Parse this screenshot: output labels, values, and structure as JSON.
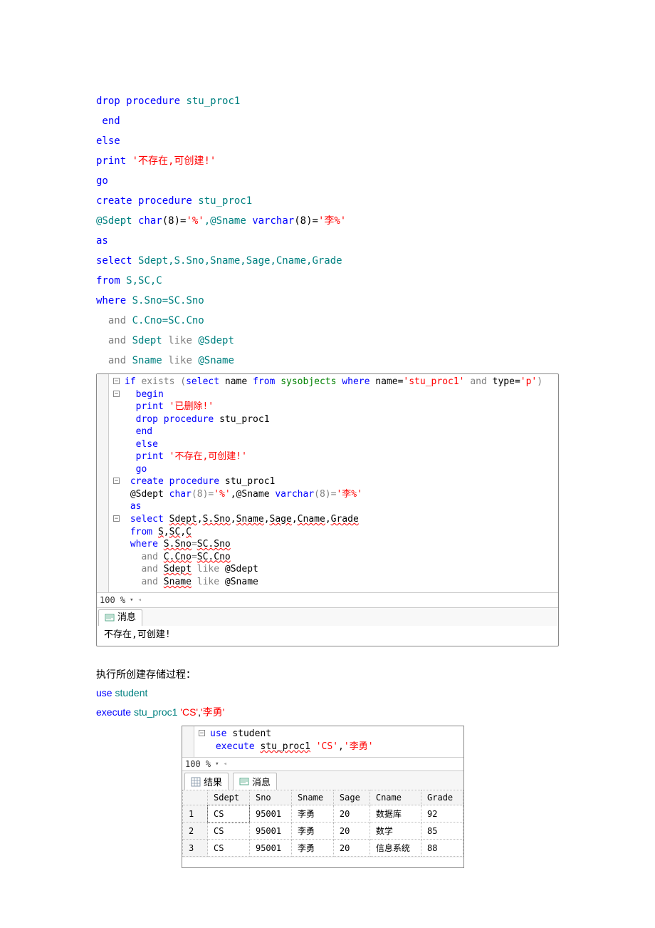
{
  "top_code": {
    "l1": " drop procedure stu_proc1",
    "l1_kw": "drop procedure",
    "l1_name": "stu_proc1",
    "l2": " end",
    "l3": "else",
    "l4a": "print",
    "l4b": "'不存在,可创建!'",
    "l5": "go",
    "l6a": "create procedure",
    "l6b": "stu_proc1",
    "l7a": "@Sdept",
    "l7b": "char",
    "l7c": "(8)=",
    "l7d": "'%'",
    "l7e": ",@Sname",
    "l7f": "varchar",
    "l7g": "(8)=",
    "l7h": "'李%'",
    "l8": "as",
    "l9a": "select",
    "l9b": "Sdept,S.Sno,Sname,Sage,Cname,Grade",
    "l10a": "from",
    "l10b": "S,SC,C",
    "l11a": "where",
    "l11b": "S.Sno=SC.Sno",
    "l12a": "and",
    "l12b": "C.Cno=SC.Cno",
    "l13a": "and",
    "l13b": "Sdept",
    "l13c": "like",
    "l13d": "@Sdept",
    "l14a": "and",
    "l14b": "Sname",
    "l14c": "like",
    "l14d": "@Sname"
  },
  "editor1": {
    "l1a": "if",
    "l1b": "exists",
    "l1c": "(",
    "l1d": "select",
    "l1e": "name",
    "l1f": "from",
    "l1g": "sysobjects",
    "l1h": "where",
    "l1i": "name=",
    "l1j": "'stu_proc1'",
    "l1k": "and",
    "l1l": "type=",
    "l1m": "'p'",
    "l1n": ")",
    "l2": "  begin",
    "l3a": "  print",
    "l3b": "'已删除!'",
    "l4a": "  drop",
    "l4b": "procedure",
    "l4c": "stu_proc1",
    "l5": "  end",
    "l6": "  else",
    "l7a": "  print",
    "l7b": "'不存在,可创建!'",
    "l8": "  go",
    "l9a": " create",
    "l9b": "procedure",
    "l9c": "stu_proc1",
    "l10a": " @Sdept",
    "l10b": "char",
    "l10c": "(8)=",
    "l10d": "'%'",
    "l10e": ",@Sname",
    "l10f": "varchar",
    "l10g": "(8)=",
    "l10h": "'李%'",
    "l11": " as",
    "l12a": " select",
    "l12b": "Sdept",
    "l12c": ",",
    "l12d": "S.Sno",
    "l12e": ",",
    "l12f": "Sname",
    "l12g": ",",
    "l12h": "Sage",
    "l12i": ",",
    "l12j": "Cname",
    "l12k": ",",
    "l12l": "Grade",
    "l13a": " from",
    "l13b": "S",
    "l13c": ",",
    "l13d": "SC",
    "l13e": ",",
    "l13f": "C",
    "l14a": " where",
    "l14b": "S.Sno",
    "l14c": "=",
    "l14d": "SC.Sno",
    "l15a": "   and",
    "l15b": "C.Cno",
    "l15c": "=",
    "l15d": "SC.Cno",
    "l16a": "   and",
    "l16b": "Sdept",
    "l16c": "like",
    "l16d": "@Sdept",
    "l17a": "   and",
    "l17b": "Sname",
    "l17c": "like",
    "l17d": "@Sname",
    "zoom": "100 %",
    "tab_msg": "消息",
    "msg_out": "不存在,可创建!"
  },
  "mid_text": "执行所创建存储过程：",
  "mid_code": {
    "l1a": "use",
    "l1b": "student",
    "l2a": "execute",
    "l2b": "stu_proc1",
    "l2c": "'CS'",
    "l2d": ",",
    "l2e": "'李勇'"
  },
  "editor2": {
    "l1a": "use",
    "l1b": "student",
    "l2a": " execute",
    "l2b": "stu_proc1",
    "l2c": "'CS'",
    "l2d": ",",
    "l2e": "'李勇'",
    "zoom": "100 %",
    "tab_result": "结果",
    "tab_msg": "消息",
    "headers": [
      "",
      "Sdept",
      "Sno",
      "Sname",
      "Sage",
      "Cname",
      "Grade"
    ],
    "rows": [
      [
        "1",
        "CS",
        "95001",
        "李勇",
        "20",
        "数据库",
        "92"
      ],
      [
        "2",
        "CS",
        "95001",
        "李勇",
        "20",
        "数学",
        "85"
      ],
      [
        "3",
        "CS",
        "95001",
        "李勇",
        "20",
        "信息系统",
        "88"
      ]
    ]
  }
}
